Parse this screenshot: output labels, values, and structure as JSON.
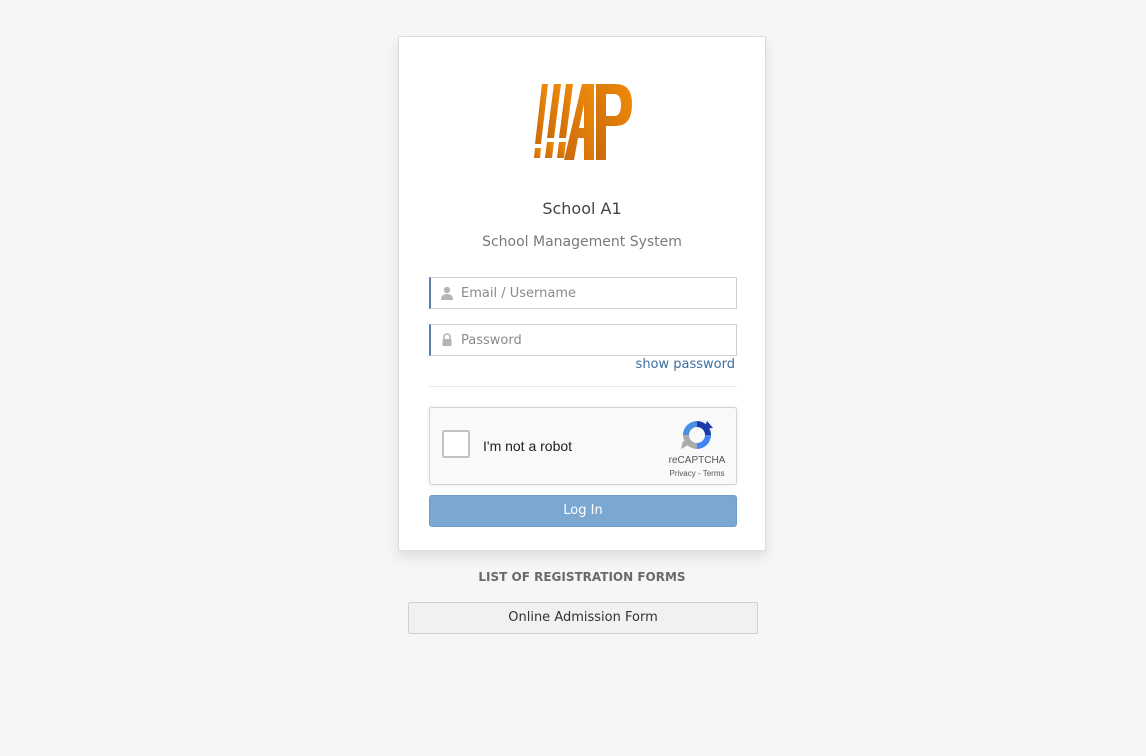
{
  "brand": {
    "logo_text": "AP",
    "logo_color": "#e07f10",
    "school_name": "School A1",
    "system_name": "School Management System"
  },
  "login_form": {
    "username_placeholder": "Email / Username",
    "username_icon": "user-icon",
    "password_placeholder": "Password",
    "password_icon": "lock-icon",
    "show_password_label": "show password",
    "login_button_label": "Log In",
    "login_button_color": "#7aa8d0",
    "input_accent_color": "#5b7ea6"
  },
  "recaptcha": {
    "checkbox_label": "I'm not a robot",
    "brand_label": "reCAPTCHA",
    "privacy_label": "Privacy",
    "separator": " - ",
    "terms_label": "Terms"
  },
  "registration": {
    "heading": "LIST OF REGISTRATION FORMS",
    "forms": [
      {
        "label": "Online Admission Form"
      }
    ]
  }
}
